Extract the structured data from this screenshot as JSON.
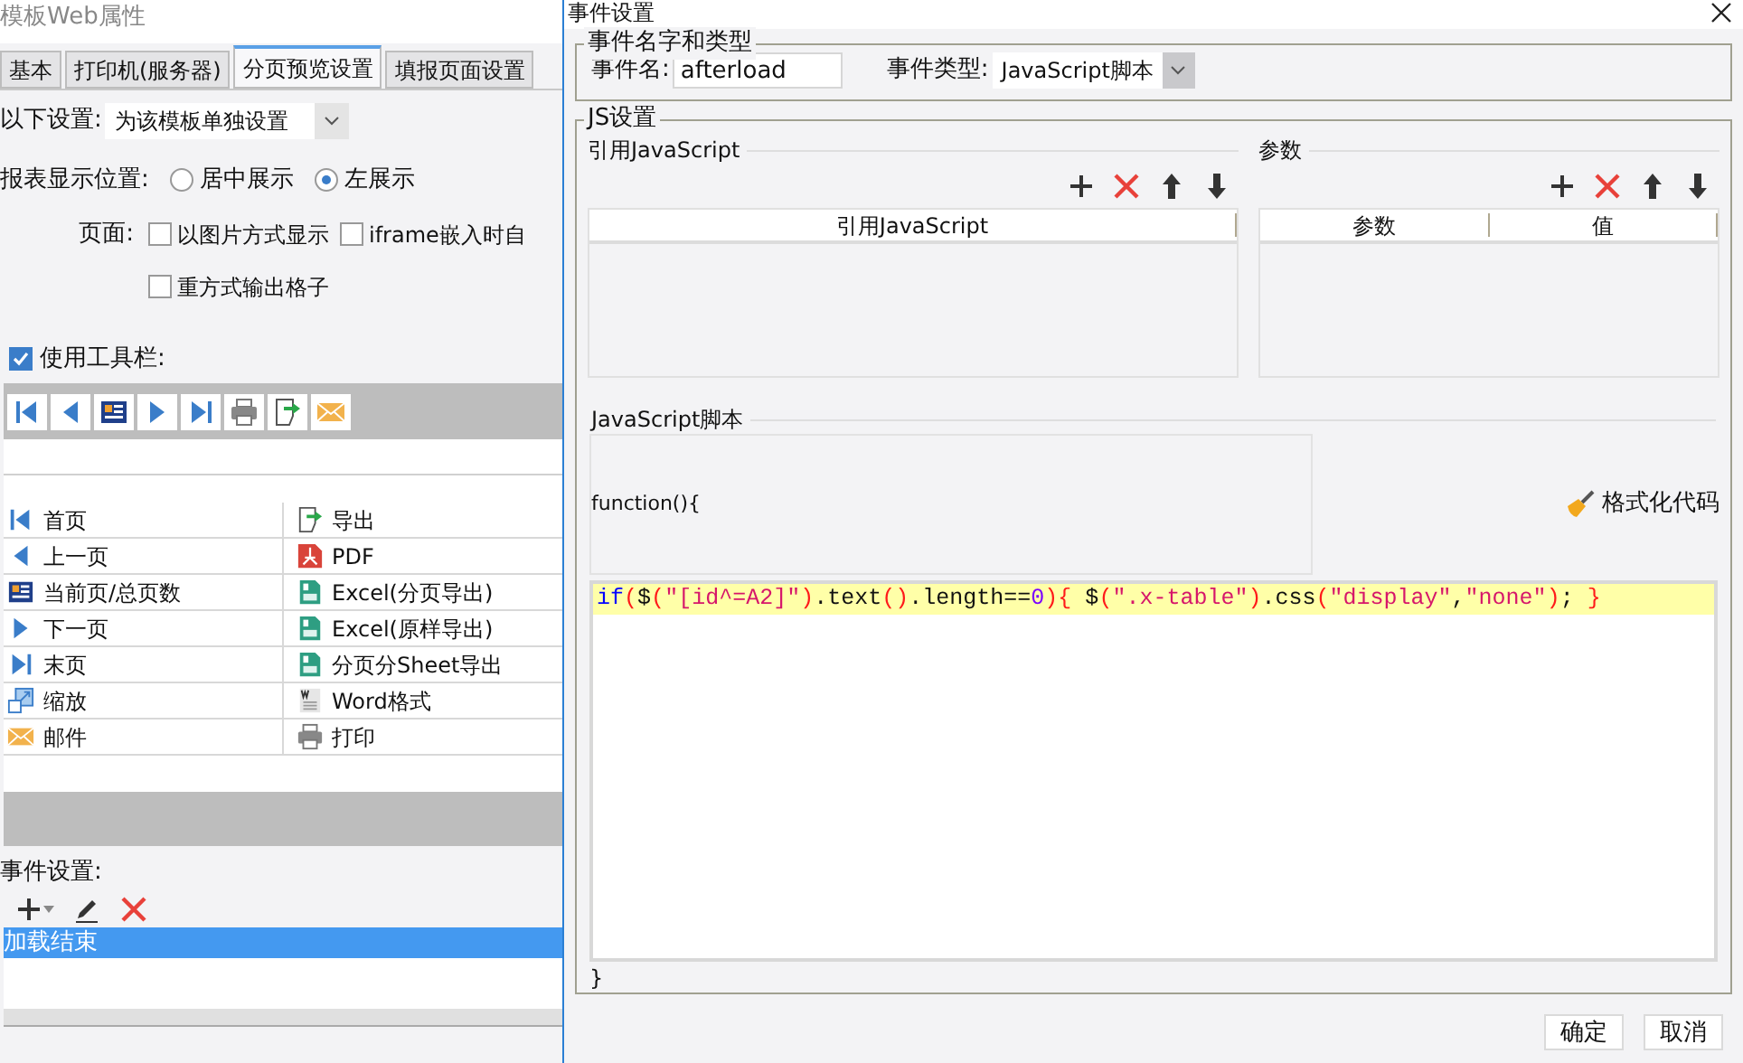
{
  "left_window": {
    "title": "模板Web属性",
    "tabs": [
      {
        "label": "基本",
        "selected": false
      },
      {
        "label": "打印机(服务器)",
        "selected": false
      },
      {
        "label": "分页预览设置",
        "selected": true
      },
      {
        "label": "填报页面设置",
        "selected": false
      }
    ],
    "settings_dropdown": {
      "label": "以下设置:",
      "value": "为该模板单独设置"
    },
    "position": {
      "label": "报表显示位置:",
      "options": [
        {
          "label": "居中展示",
          "selected": false
        },
        {
          "label": "左展示",
          "selected": true
        }
      ]
    },
    "page": {
      "label": "页面:",
      "options": [
        {
          "label": "以图片方式显示",
          "checked": false
        },
        {
          "label": "iframe嵌入时自",
          "checked": false
        },
        {
          "label": "重方式输出格子",
          "checked": false
        }
      ]
    },
    "use_toolbar": {
      "label": "使用工具栏:",
      "checked": true
    },
    "toolbar_buttons": [
      {
        "kind": "first"
      },
      {
        "kind": "prev"
      },
      {
        "kind": "page"
      },
      {
        "kind": "next"
      },
      {
        "kind": "last"
      },
      {
        "kind": "print"
      },
      {
        "kind": "export"
      },
      {
        "kind": "mail"
      }
    ],
    "tool_rows": [
      {
        "left": {
          "kind": "first",
          "label": "首页"
        },
        "right": {
          "kind": "export",
          "label": "导出"
        }
      },
      {
        "left": {
          "kind": "prev",
          "label": "上一页"
        },
        "right": {
          "kind": "pdf",
          "label": "PDF"
        }
      },
      {
        "left": {
          "kind": "page",
          "label": "当前页/总页数"
        },
        "right": {
          "kind": "excel",
          "label": "Excel(分页导出)"
        }
      },
      {
        "left": {
          "kind": "next",
          "label": "下一页"
        },
        "right": {
          "kind": "excel",
          "label": "Excel(原样导出)"
        }
      },
      {
        "left": {
          "kind": "last",
          "label": "末页"
        },
        "right": {
          "kind": "excel",
          "label": "分页分Sheet导出"
        }
      },
      {
        "left": {
          "kind": "zoom",
          "label": "缩放"
        },
        "right": {
          "kind": "word",
          "label": "Word格式"
        }
      },
      {
        "left": {
          "kind": "mail",
          "label": "邮件"
        },
        "right": {
          "kind": "print",
          "label": "打印"
        }
      }
    ],
    "events_label": "事件设置:",
    "event_tools": [
      {
        "kind": "add"
      },
      {
        "kind": "edit"
      },
      {
        "kind": "delete"
      }
    ],
    "events": [
      {
        "label": "加载结束",
        "selected": true
      }
    ]
  },
  "dialog": {
    "title": "事件设置",
    "name_type_group": {
      "title": "事件名字和类型",
      "name_label": "事件名:",
      "name_value": "afterload",
      "type_label": "事件类型:",
      "type_value": "JavaScript脚本"
    },
    "js_group": {
      "title": "JS设置",
      "references": {
        "title": "引用JavaScript",
        "tools": [
          {
            "kind": "add"
          },
          {
            "kind": "delete"
          },
          {
            "kind": "up"
          },
          {
            "kind": "down"
          }
        ],
        "columns": [
          "引用JavaScript"
        ]
      },
      "parameters": {
        "title": "参数",
        "tools": [
          {
            "kind": "add"
          },
          {
            "kind": "delete"
          },
          {
            "kind": "up"
          },
          {
            "kind": "down"
          }
        ],
        "columns": [
          "参数",
          "值"
        ]
      },
      "script": {
        "title": "JavaScript脚本",
        "header": "function(){",
        "format_button": "格式化代码",
        "code_line": [
          {
            "kind": "keyword",
            "text": "if"
          },
          {
            "kind": "punct",
            "text": "("
          },
          {
            "kind": "plain",
            "text": "$"
          },
          {
            "kind": "punct",
            "text": "("
          },
          {
            "kind": "string",
            "text": "\"[id^=A2]\""
          },
          {
            "kind": "punct",
            "text": ")"
          },
          {
            "kind": "plain",
            "text": ".text"
          },
          {
            "kind": "punct",
            "text": "()"
          },
          {
            "kind": "plain",
            "text": ".length=="
          },
          {
            "kind": "number",
            "text": "0"
          },
          {
            "kind": "punct",
            "text": "){"
          },
          {
            "kind": "plain",
            "text": " $"
          },
          {
            "kind": "punct",
            "text": "("
          },
          {
            "kind": "string",
            "text": "\".x-table\""
          },
          {
            "kind": "punct",
            "text": ")"
          },
          {
            "kind": "plain",
            "text": ".css"
          },
          {
            "kind": "punct",
            "text": "("
          },
          {
            "kind": "string",
            "text": "\"display\""
          },
          {
            "kind": "plain",
            "text": ","
          },
          {
            "kind": "string",
            "text": "\"none\""
          },
          {
            "kind": "punct",
            "text": ")"
          },
          {
            "kind": "plain",
            "text": "; "
          },
          {
            "kind": "punct",
            "text": "}"
          }
        ],
        "footer": "}"
      }
    },
    "buttons": [
      "确定",
      "取消"
    ]
  }
}
